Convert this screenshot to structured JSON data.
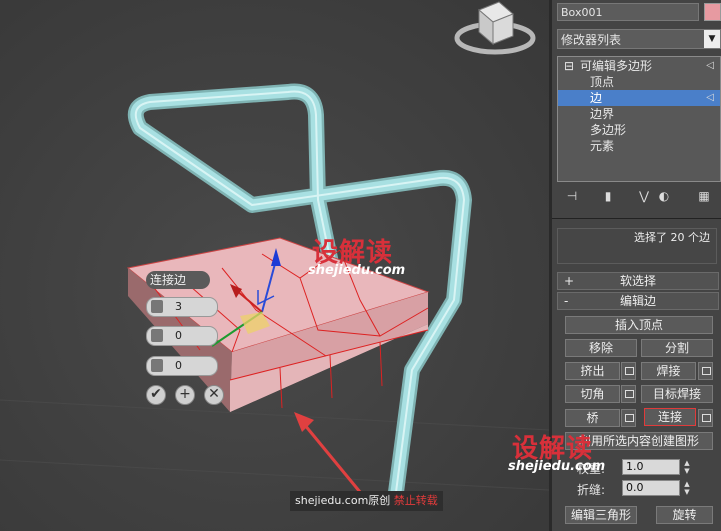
{
  "viewport": {
    "caddy": {
      "title": "连接边",
      "segments": "3",
      "pinch": "0",
      "slide": "0",
      "ok": "✔",
      "apply": "+",
      "cancel": "✕"
    },
    "watermark_center": {
      "cn": "设解读",
      "url": "shejiedu.com"
    },
    "watermark_right": {
      "cn": "设解读",
      "url": "shejiedu.com"
    },
    "credit": {
      "text": "shejiedu.com原创",
      "ban": "禁止转载"
    }
  },
  "panel": {
    "object_name": "Box001",
    "object_color": "#e79aa1",
    "modifier_list": "修改器列表",
    "stack": [
      {
        "label": "可编辑多边形",
        "prefix": "⊟",
        "selected": false
      },
      {
        "label": "顶点",
        "prefix": "",
        "selected": false
      },
      {
        "label": "边",
        "prefix": "",
        "selected": true
      },
      {
        "label": "边界",
        "prefix": "",
        "selected": false
      },
      {
        "label": "多边形",
        "prefix": "",
        "selected": false
      },
      {
        "label": "元素",
        "prefix": "",
        "selected": false
      }
    ],
    "selection_info": "选择了 20 个边",
    "soft_select": {
      "sign": "+",
      "label": "软选择"
    },
    "edit_edges": {
      "sign": "-",
      "label": "编辑边"
    },
    "buttons": {
      "insert_vertex": "插入顶点",
      "remove": "移除",
      "split": "分割",
      "extrude": "挤出",
      "weld": "焊接",
      "chamfer": "切角",
      "target_weld": "目标焊接",
      "bridge": "桥",
      "connect": "连接",
      "create_shape": "利用所选内容创建图形",
      "edit_tri": "编辑三角形",
      "turn": "旋转"
    },
    "weight": {
      "label": "权重:",
      "value": "1.0"
    },
    "crease": {
      "label": "折缝:",
      "value": "0.0"
    }
  }
}
